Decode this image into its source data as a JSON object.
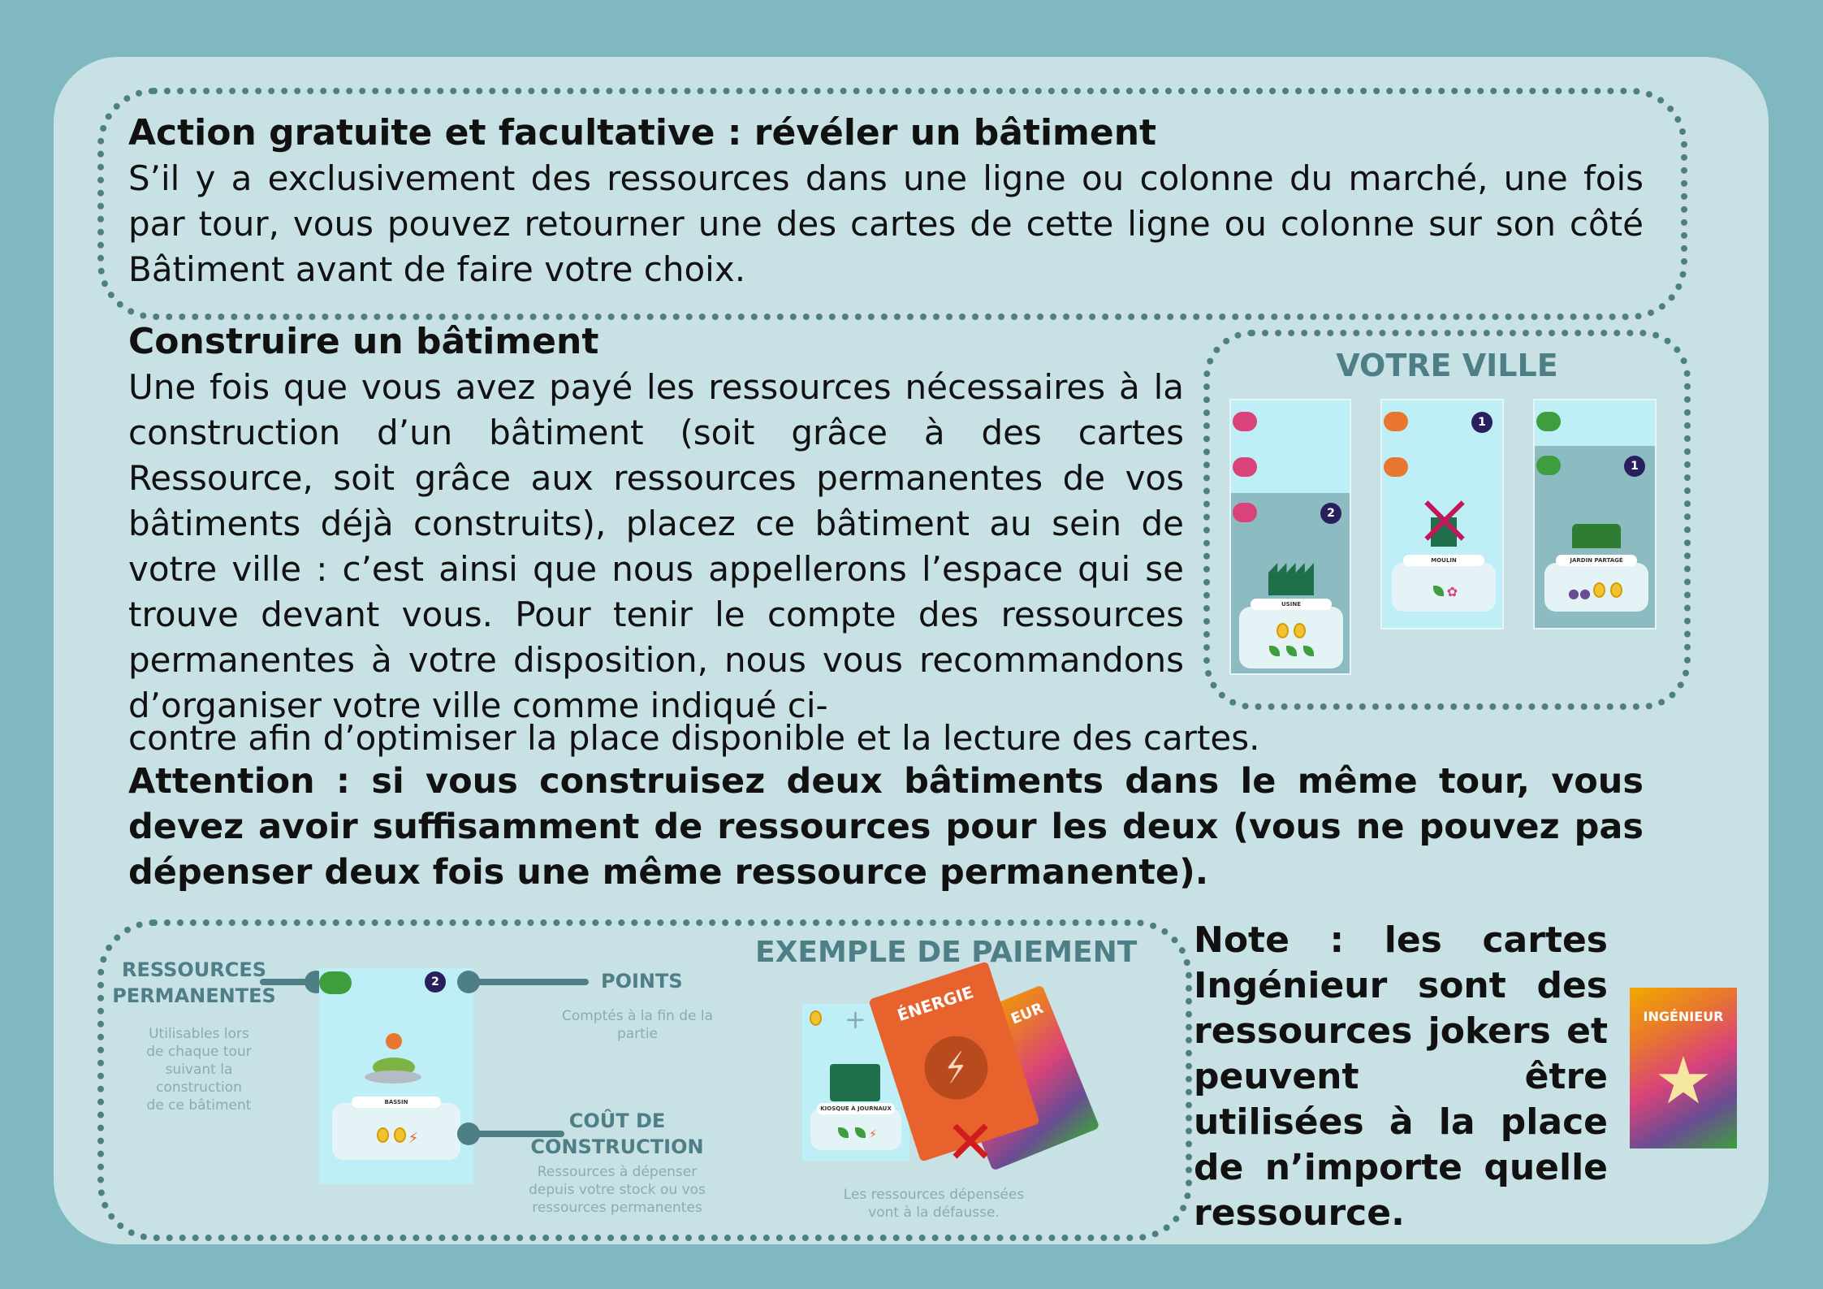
{
  "free_action": {
    "title": "Action gratuite et facultative : révéler un bâtiment",
    "body": "S’il y a exclusivement des ressources dans une ligne ou colonne du marché, une fois par tour, vous pouvez retourner une des cartes de cette ligne ou colonne sur son côté Bâtiment avant de faire votre choix."
  },
  "build": {
    "title": "Construire un bâtiment",
    "body_wrapped": "Une fois que vous avez payé les ressources nécessaires à la construction d’un bâtiment (soit grâce à des cartes Ressource, soit grâce aux ressources permanentes de vos bâtiments déjà construits), placez ce bâtiment au sein de votre ville : c’est ainsi que nous appellerons l’espace qui se trouve devant vous. Pour tenir le compte des ressources permanentes à votre disposition, nous vous recommandons d’organiser votre ville comme indiqué ci-",
    "body_tail": "contre afin d’optimiser la place disponible et la lecture des cartes.",
    "warning": "Attention : si vous construisez deux bâtiments dans le même tour, vous devez avoir suffisamment de ressources pour les deux (vous ne pouvez pas dépenser deux fois une même ressource permanente)."
  },
  "city": {
    "title": "VOTRE VILLE",
    "cards": [
      {
        "name": "USINE",
        "points": "2"
      },
      {
        "name": "MOULIN",
        "points": "1"
      },
      {
        "name": "JARDIN PARTAGÉ",
        "points": "1"
      }
    ]
  },
  "example": {
    "title": "EXEMPLE DE PAIEMENT",
    "perm_label": "RESSOURCES PERMANENTES",
    "perm_desc": "Utilisables lors de chaque tour suivant la construction de ce bâtiment",
    "points_label": "POINTS",
    "points_desc": "Comptés à la fin de la partie",
    "cost_label": "COÛT DE CONSTRUCTION",
    "cost_desc": "Ressources à dépenser depuis votre stock ou vos ressources permanentes",
    "card_name": "BASSIN",
    "card_points": "2",
    "kiosk_name": "KIOSQUE À JOURNAUX",
    "energy_card": "ÉNERGIE",
    "back_card_partial": "EUR",
    "plus": "+",
    "spent_note": "Les ressources dépensées vont à la défausse."
  },
  "note": {
    "text": "Note : les cartes Ingénieur sont des ressources jokers et peuvent être utilisées à la place de n’importe quelle ressource.",
    "card_label": "INGÉNIEUR"
  },
  "colors": {
    "background": "#7fb8c0",
    "panel": "#c8e1e4",
    "accent": "#4e7f86"
  }
}
